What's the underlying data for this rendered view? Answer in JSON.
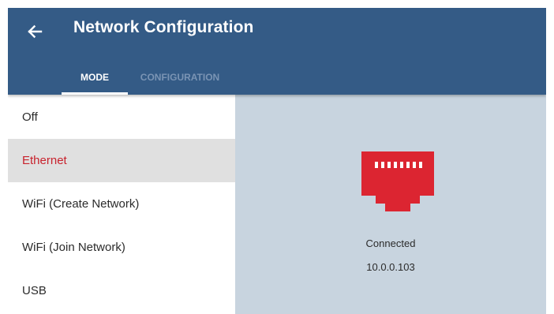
{
  "header": {
    "title": "Network Configuration",
    "back_icon": "arrow-left-icon",
    "background_color": "#345b86"
  },
  "tabs": [
    {
      "label": "MODE",
      "active": true
    },
    {
      "label": "CONFIGURATION",
      "active": false
    }
  ],
  "sidebar": {
    "items": [
      {
        "label": "Off",
        "selected": false
      },
      {
        "label": "Ethernet",
        "selected": true
      },
      {
        "label": "WiFi (Create Network)",
        "selected": false
      },
      {
        "label": "WiFi (Join Network)",
        "selected": false
      },
      {
        "label": "USB",
        "selected": false
      }
    ],
    "selected_color": "#c8222d"
  },
  "content": {
    "icon": "ethernet-port-icon",
    "icon_color": "#dc2531",
    "status": "Connected",
    "ip_address": "10.0.0.103",
    "background_color": "#c8d4df"
  }
}
